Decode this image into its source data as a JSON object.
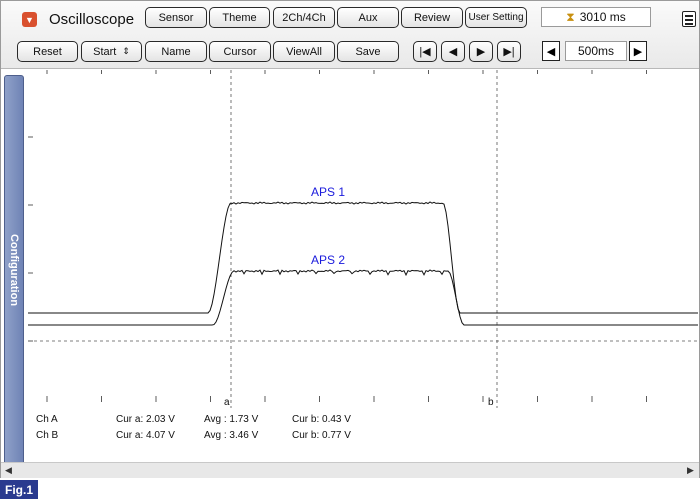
{
  "app": {
    "title": "Oscilloscope",
    "top_buttons": [
      "Sensor",
      "Theme",
      "2Ch/4Ch",
      "Aux",
      "Review",
      "User Setting"
    ],
    "elapsed_time": "3010 ms"
  },
  "toolbar": {
    "reset": "Reset",
    "start": "Start",
    "name": "Name",
    "cursor": "Cursor",
    "viewall": "ViewAll",
    "save": "Save",
    "nav_first": "|◀",
    "nav_prev": "◀",
    "nav_next": "▶",
    "nav_last": "▶|",
    "timebase_dec": "◀",
    "timebase_value": "500ms",
    "timebase_inc": "▶"
  },
  "sidebar": {
    "configuration_label": "Configuration"
  },
  "cursors": {
    "a_label": "a",
    "b_label": "b"
  },
  "readouts": [
    {
      "channel": "Ch A",
      "cur_a": "Cur a: 2.03 V",
      "avg": "Avg : 1.73 V",
      "cur_b": "Cur b: 0.43 V"
    },
    {
      "channel": "Ch B",
      "cur_a": "Cur a: 4.07 V",
      "avg": "Avg : 3.46 V",
      "cur_b": "Cur b: 0.77 V"
    }
  ],
  "chart_data": {
    "type": "line",
    "series": [
      {
        "name": "APS 1",
        "shape": "pulse",
        "baseline": 0.43,
        "high": 2.03
      },
      {
        "name": "APS 2",
        "shape": "pulse",
        "baseline": 0.77,
        "high": 4.07
      }
    ],
    "colors": {
      "trace": "#111111",
      "label": "#1a1adc"
    }
  },
  "figure": {
    "label": "Fig.1"
  }
}
